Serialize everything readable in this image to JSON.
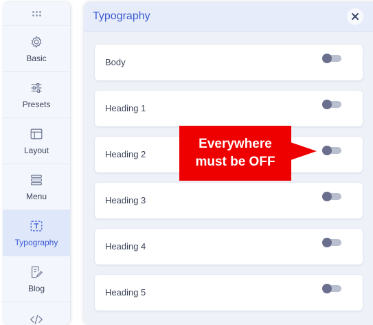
{
  "sidebar": {
    "items": [
      {
        "label": "Basic",
        "icon": "gear-icon"
      },
      {
        "label": "Presets",
        "icon": "sliders-icon"
      },
      {
        "label": "Layout",
        "icon": "layout-icon"
      },
      {
        "label": "Menu",
        "icon": "menu-list-icon"
      },
      {
        "label": "Typography",
        "icon": "text-box-icon",
        "active": true
      },
      {
        "label": "Blog",
        "icon": "blog-edit-icon"
      },
      {
        "label": "",
        "icon": "code-icon"
      }
    ]
  },
  "panel": {
    "title": "Typography",
    "rows": [
      {
        "label": "Body",
        "enabled": false
      },
      {
        "label": "Heading 1",
        "enabled": false
      },
      {
        "label": "Heading 2",
        "enabled": false
      },
      {
        "label": "Heading 3",
        "enabled": false
      },
      {
        "label": "Heading 4",
        "enabled": false
      },
      {
        "label": "Heading 5",
        "enabled": false
      }
    ]
  },
  "callout": {
    "line1": "Everywhere",
    "line2": "must be OFF"
  },
  "colors": {
    "accent": "#3b5bd3",
    "callout": "#ee0000",
    "toggle_knob": "#6b6f8e",
    "toggle_track": "#b9bfcf"
  }
}
